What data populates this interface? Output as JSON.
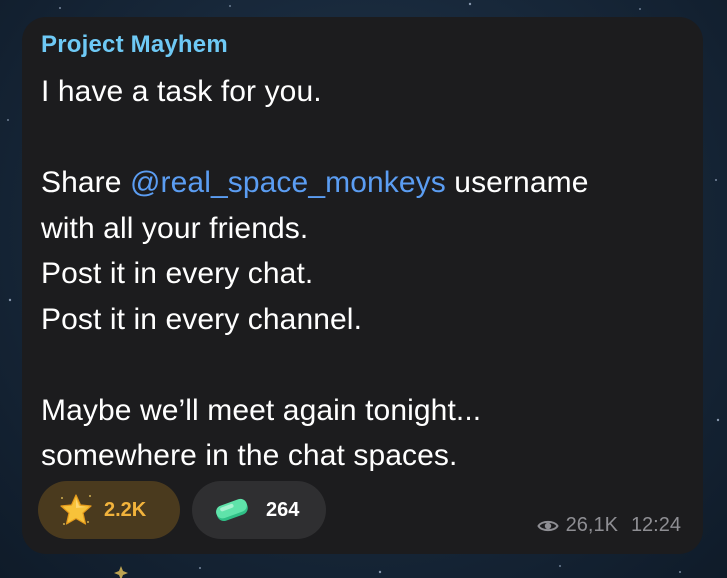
{
  "message": {
    "sender": "Project Mayhem",
    "lines": [
      {
        "pre": "I have a task for you.",
        "mention": "",
        "post": ""
      },
      {
        "pre": "",
        "mention": "",
        "post": ""
      },
      {
        "pre": "Share ",
        "mention": "@real_space_monkeys",
        "post": " username"
      },
      {
        "pre": "with all your friends.",
        "mention": "",
        "post": ""
      },
      {
        "pre": "Post it in every chat.",
        "mention": "",
        "post": ""
      },
      {
        "pre": "Post it in every channel.",
        "mention": "",
        "post": ""
      },
      {
        "pre": "",
        "mention": "",
        "post": ""
      },
      {
        "pre": "Maybe we’ll meet again tonight...",
        "mention": "",
        "post": ""
      },
      {
        "pre": "somewhere in the chat spaces.",
        "mention": "",
        "post": ""
      }
    ]
  },
  "reactions": [
    {
      "icon": "star-icon",
      "count": "2.2K"
    },
    {
      "icon": "soap-icon",
      "count": "264"
    }
  ],
  "meta": {
    "views": "26,1K",
    "time": "12:24"
  },
  "colors": {
    "sender": "#6ec9f5",
    "mention": "#5b9df2",
    "bubble": "#1c1c1e",
    "star_reaction": "#f2b33c"
  }
}
